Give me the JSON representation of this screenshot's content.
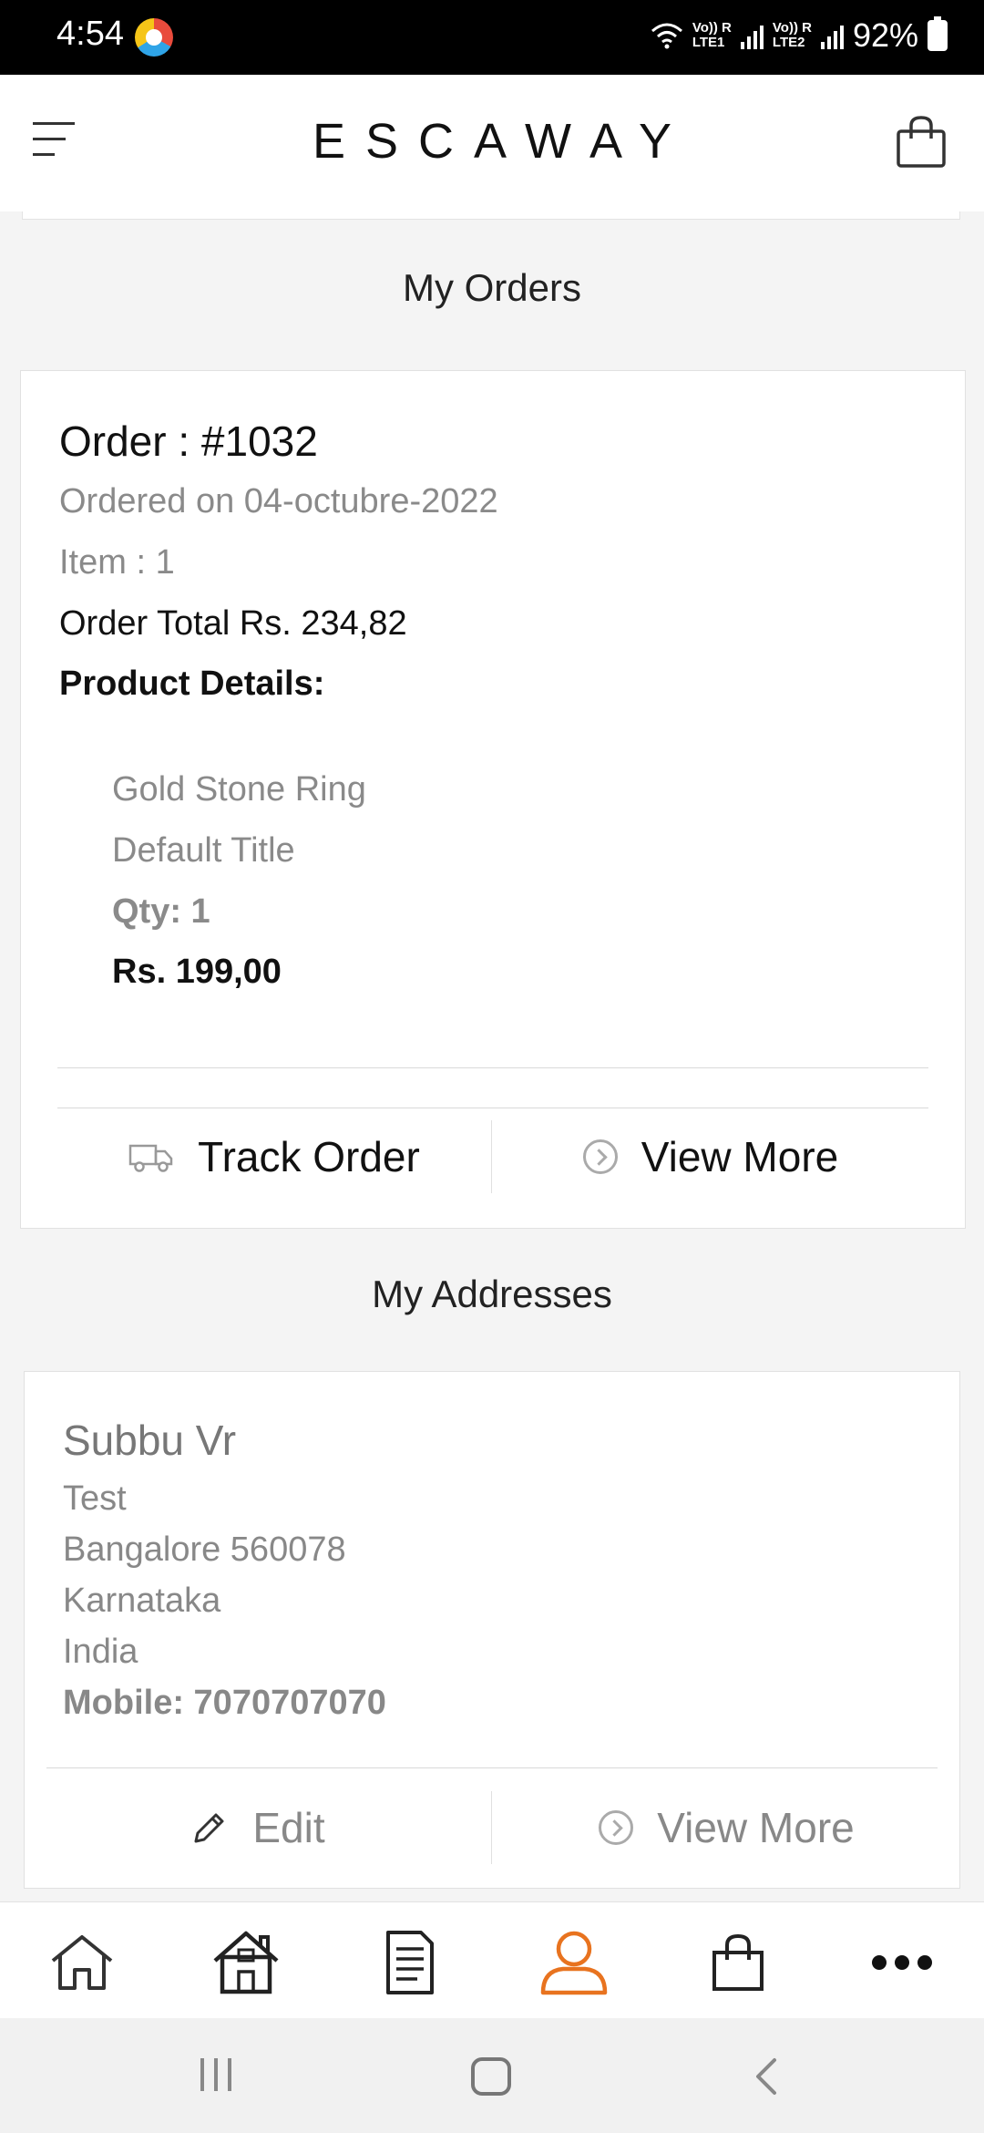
{
  "status_bar": {
    "time": "4:54",
    "network1": "Vo)) R\nLTE1",
    "network2": "Vo)) R\nLTE2",
    "battery": "92%"
  },
  "header": {
    "brand": "ESCAWAY",
    "menu_icon": "hamburger-menu-icon",
    "cart_icon": "shopping-bag-icon"
  },
  "orders": {
    "section_title": "My Orders",
    "order": {
      "title": "Order : #1032",
      "ordered_on": "Ordered on 04-octubre-2022",
      "items": "Item : 1",
      "total": "Order Total Rs. 234,82",
      "details_label": "Product Details:",
      "product": {
        "name": "Gold Stone Ring",
        "variant": "Default Title",
        "qty": "Qty: 1",
        "price": "Rs. 199,00"
      },
      "track_label": "Track Order",
      "view_more_label": "View More"
    }
  },
  "addresses": {
    "section_title": "My Addresses",
    "address": {
      "name": "Subbu Vr",
      "line1": "Test",
      "line2": "Bangalore 560078",
      "state": "Karnataka",
      "country": "India",
      "mobile_label": "Mobile:",
      "mobile": "7070707070",
      "edit_label": "Edit",
      "view_more_label": "View More"
    }
  },
  "bottom_nav": {
    "items": [
      "home-icon",
      "store-icon",
      "orders-icon",
      "account-icon",
      "cart-icon",
      "more-icon"
    ],
    "active": "account-icon",
    "active_color": "#e8731f"
  }
}
